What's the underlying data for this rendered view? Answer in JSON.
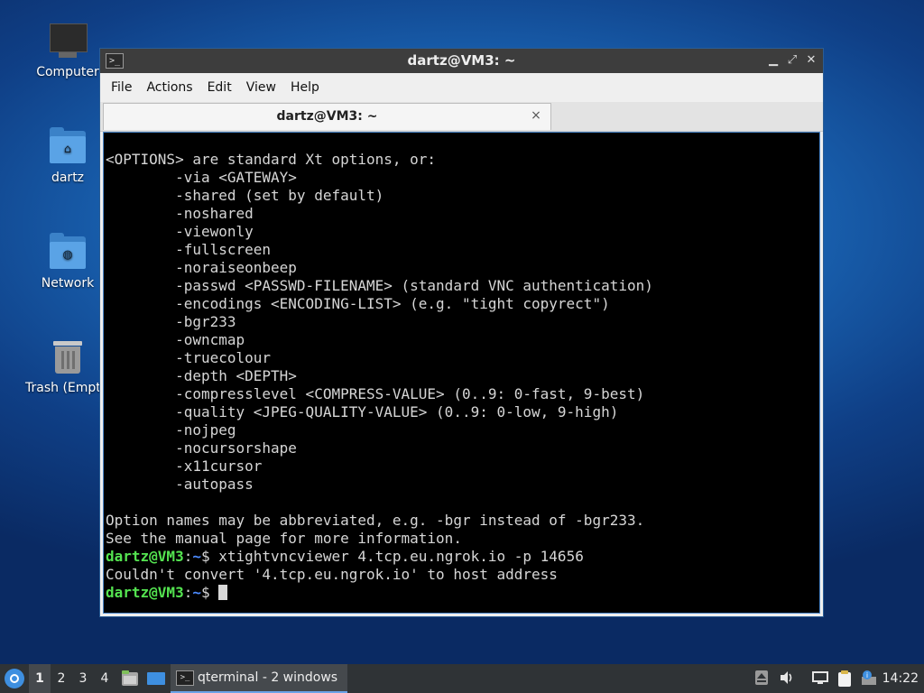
{
  "desktop": {
    "icons": [
      {
        "label": "Computer",
        "icon": "computer-icon"
      },
      {
        "label": "dartz",
        "icon": "home-folder-icon"
      },
      {
        "label": "Network",
        "icon": "network-folder-icon"
      },
      {
        "label": "Trash (Empty)",
        "icon": "trash-icon"
      }
    ]
  },
  "window": {
    "title": "dartz@VM3: ~",
    "app_icon_glyph": ">_",
    "controls": {
      "minimize": "▁",
      "maximize": "⤢",
      "close": "✕"
    },
    "menu": [
      "File",
      "Actions",
      "Edit",
      "View",
      "Help"
    ],
    "tab": {
      "label": "dartz@VM3: ~",
      "close": "×"
    }
  },
  "terminal": {
    "lines": [
      "<OPTIONS> are standard Xt options, or:",
      "        -via <GATEWAY>",
      "        -shared (set by default)",
      "        -noshared",
      "        -viewonly",
      "        -fullscreen",
      "        -noraiseonbeep",
      "        -passwd <PASSWD-FILENAME> (standard VNC authentication)",
      "        -encodings <ENCODING-LIST> (e.g. \"tight copyrect\")",
      "        -bgr233",
      "        -owncmap",
      "        -truecolour",
      "        -depth <DEPTH>",
      "        -compresslevel <COMPRESS-VALUE> (0..9: 0-fast, 9-best)",
      "        -quality <JPEG-QUALITY-VALUE> (0..9: 0-low, 9-high)",
      "        -nojpeg",
      "        -nocursorshape",
      "        -x11cursor",
      "        -autopass",
      "",
      "Option names may be abbreviated, e.g. -bgr instead of -bgr233.",
      "See the manual page for more information."
    ],
    "prompt_user": "dartz@VM3",
    "prompt_sep": ":",
    "prompt_path": "~",
    "prompt_symbol": "$ ",
    "command": "xtightvncviewer 4.tcp.eu.ngrok.io -p 14656",
    "error": "Couldn't convert '4.tcp.eu.ngrok.io' to host address"
  },
  "taskbar": {
    "workspaces": [
      "1",
      "2",
      "3",
      "4"
    ],
    "active_workspace": "1",
    "task_label": "qterminal - 2 windows",
    "task_icon_glyph": ">_",
    "clock": "14:22",
    "tray_icons": [
      "eject-icon",
      "volume-icon",
      "network-icon",
      "clipboard-icon",
      "update-icon"
    ]
  },
  "colors": {
    "prompt_user": "#54e350",
    "prompt_path": "#4c8bff",
    "terminal_bg": "#000000",
    "terminal_fg": "#d6d6d6"
  }
}
